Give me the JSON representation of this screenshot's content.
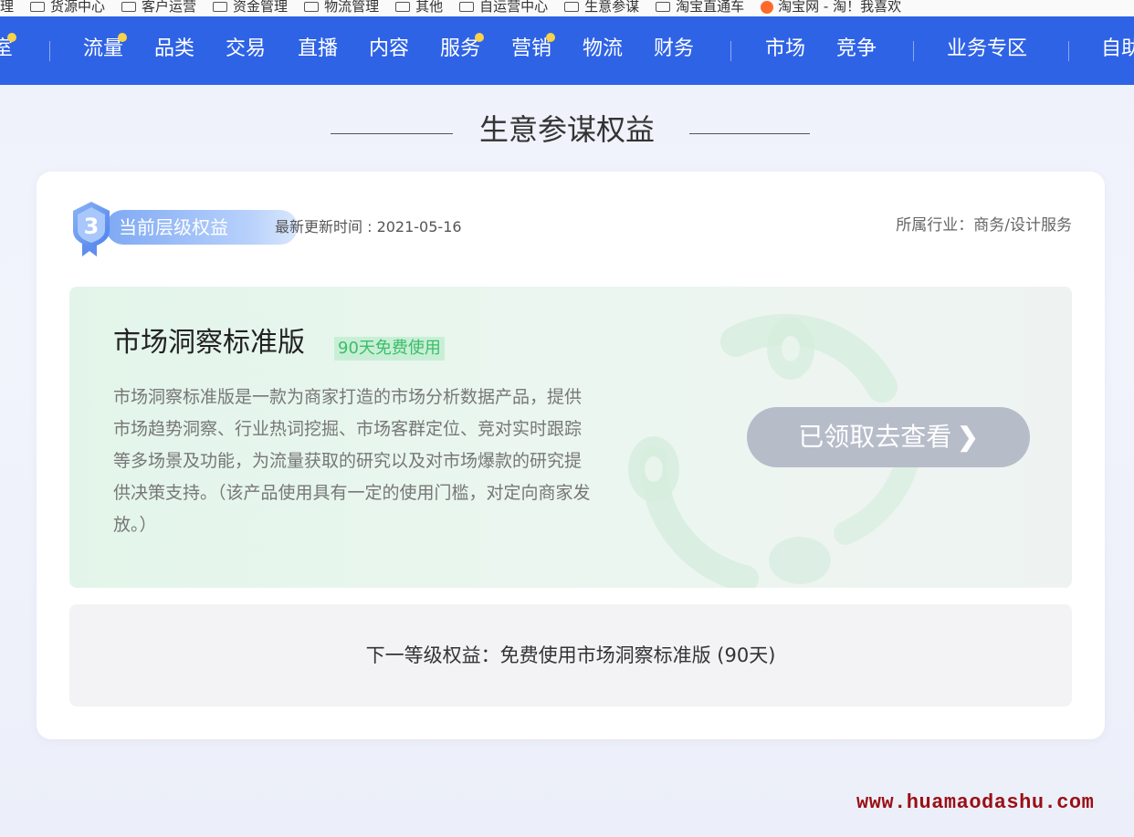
{
  "bookmarks": [
    {
      "label": "理",
      "icon": "folder-icon"
    },
    {
      "label": "货源中心",
      "icon": "folder-icon"
    },
    {
      "label": "客户运营",
      "icon": "folder-icon"
    },
    {
      "label": "资金管理",
      "icon": "folder-icon"
    },
    {
      "label": "物流管理",
      "icon": "folder-icon"
    },
    {
      "label": "其他",
      "icon": "folder-icon"
    },
    {
      "label": "自运营中心",
      "icon": "folder-icon"
    },
    {
      "label": "生意参谋",
      "icon": "folder-icon"
    },
    {
      "label": "淘宝直通车",
      "icon": "folder-icon"
    },
    {
      "label": "淘宝网 - 淘！我喜欢",
      "icon": "taobao-favicon"
    }
  ],
  "nav": {
    "items": [
      {
        "label": "室",
        "dot": true
      },
      {
        "label": "流量",
        "dot": true
      },
      {
        "label": "品类",
        "dot": false
      },
      {
        "label": "交易",
        "dot": false
      },
      {
        "label": "直播",
        "dot": false
      },
      {
        "label": "内容",
        "dot": false
      },
      {
        "label": "服务",
        "dot": true
      },
      {
        "label": "营销",
        "dot": true
      },
      {
        "label": "物流",
        "dot": false
      },
      {
        "label": "财务",
        "dot": false
      },
      {
        "label": "市场",
        "dot": false
      },
      {
        "label": "竞争",
        "dot": false
      },
      {
        "label": "业务专区",
        "dot": false
      },
      {
        "label": "自助",
        "dot": false
      }
    ],
    "background": "#2f63e6",
    "dot_color": "#f7d24b"
  },
  "section": {
    "title": "生意参谋权益"
  },
  "card": {
    "tier_level": "3",
    "tier_label": "当前层级权益",
    "update_time": "最新更新时间 : 2021-05-16",
    "industry": "所属行业：商务/设计服务",
    "feature": {
      "title": "市场洞察标准版",
      "tag": "90天免费使用",
      "description": "市场洞察标准版是一款为商家打造的市场分析数据产品，提供市场趋势洞察、行业热词挖掘、市场客群定位、竞对实时跟踪等多场景及功能，为流量获取的研究以及对市场爆款的研究提供决策支持。（该产品使用具有一定的使用门槛，对定向商家发放。）",
      "button_label": "已领取去查看",
      "button_icon": "chevron-right-icon"
    },
    "next_tier": "下一等级权益：免费使用市场洞察标准版 (90天)"
  },
  "colors": {
    "accent_green": "#3bbd69",
    "tag_bg": "#c8efd5",
    "button_disabled": "#b7bcc9",
    "badge_blue": "#7fa9f4"
  },
  "watermark": "www.huamaodashu.com"
}
